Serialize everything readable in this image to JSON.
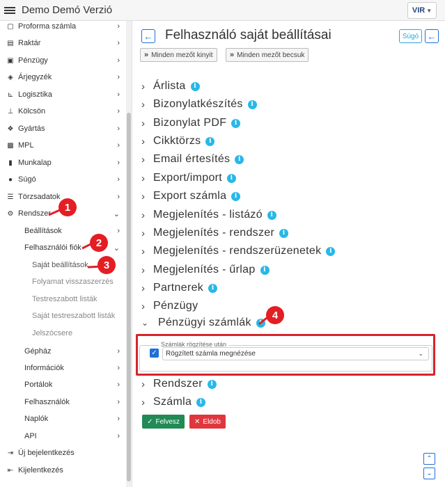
{
  "app": {
    "title": "Demo Demó Verzió",
    "logo_text": "VIR"
  },
  "sidebar": {
    "items": [
      {
        "label": "Proforma számla",
        "icon": "file-icon",
        "has_chevron": true
      },
      {
        "label": "Raktár",
        "icon": "warehouse-icon",
        "has_chevron": true
      },
      {
        "label": "Pénzügy",
        "icon": "money-icon",
        "has_chevron": true
      },
      {
        "label": "Árjegyzék",
        "icon": "tag-icon",
        "has_chevron": true
      },
      {
        "label": "Logisztika",
        "icon": "dolly-icon",
        "has_chevron": true
      },
      {
        "label": "Kölcsön",
        "icon": "hand-icon",
        "has_chevron": true
      },
      {
        "label": "Gyártás",
        "icon": "cubes-icon",
        "has_chevron": true
      },
      {
        "label": "MPL",
        "icon": "mpl-icon",
        "has_chevron": true
      },
      {
        "label": "Munkalap",
        "icon": "document-icon",
        "has_chevron": true
      },
      {
        "label": "Súgó",
        "icon": "question-icon",
        "has_chevron": true
      },
      {
        "label": "Törzsadatok",
        "icon": "database-icon",
        "has_chevron": true
      },
      {
        "label": "Rendszer",
        "icon": "cogs-icon",
        "has_chevron": true,
        "expanded": true
      }
    ],
    "rendszer_children": [
      {
        "label": "Beállítások",
        "has_chevron": true
      },
      {
        "label": "Felhasználói fiók",
        "has_chevron": true,
        "expanded": true
      }
    ],
    "fiok_children": [
      {
        "label": "Saját beállítások",
        "active": true
      },
      {
        "label": "Folyamat visszaszerzés"
      },
      {
        "label": "Testreszabott listák"
      },
      {
        "label": "Saját testreszabott listák"
      },
      {
        "label": "Jelszócsere"
      }
    ],
    "rendszer_more": [
      {
        "label": "Gépház"
      },
      {
        "label": "Információk"
      },
      {
        "label": "Portálok"
      },
      {
        "label": "Felhasználók"
      },
      {
        "label": "Naplók"
      },
      {
        "label": "API"
      }
    ],
    "bottom": [
      {
        "label": "Új bejelentkezés",
        "icon": "login-icon"
      },
      {
        "label": "Kijelentkezés",
        "icon": "logout-icon"
      }
    ]
  },
  "main": {
    "title": "Felhasználó saját beállításai",
    "help_label": "Súgó",
    "expand_all_label": "Minden mezőt kinyit",
    "collapse_all_label": "Minden mezőt becsuk",
    "sections": [
      {
        "label": "Árlista",
        "info": true
      },
      {
        "label": "Bizonylatkészítés",
        "info": true
      },
      {
        "label": "Bizonylat PDF",
        "info": true
      },
      {
        "label": "Cikktörzs",
        "info": true
      },
      {
        "label": "Email értesítés",
        "info": true
      },
      {
        "label": "Export/import",
        "info": true
      },
      {
        "label": "Export számla",
        "info": true
      },
      {
        "label": "Megjelenítés - listázó",
        "info": true
      },
      {
        "label": "Megjelenítés - rendszer",
        "info": true
      },
      {
        "label": "Megjelenítés - rendszerüzenetek",
        "info": true
      },
      {
        "label": "Megjelenítés - űrlap",
        "info": true
      },
      {
        "label": "Partnerek",
        "info": true
      },
      {
        "label": "Pénzügy",
        "info": false
      },
      {
        "label": "Pénzügyi számlák",
        "info": true,
        "expanded": true
      }
    ],
    "penzugyi_szamlak": {
      "legend": "Számlák rögzítése után",
      "checked": true,
      "select_value": "Rögzített számla megnézése"
    },
    "sections_after": [
      {
        "label": "Rendszer",
        "info": true
      },
      {
        "label": "Számla",
        "info": true
      }
    ],
    "save_label": "Felvesz",
    "discard_label": "Eldob"
  },
  "callouts": [
    "1",
    "2",
    "3",
    "4"
  ],
  "colors": {
    "primary": "#1e6fd9",
    "info": "#27b8e8",
    "save": "#218a55",
    "discard": "#e0363d",
    "callout": "#e31e24"
  }
}
